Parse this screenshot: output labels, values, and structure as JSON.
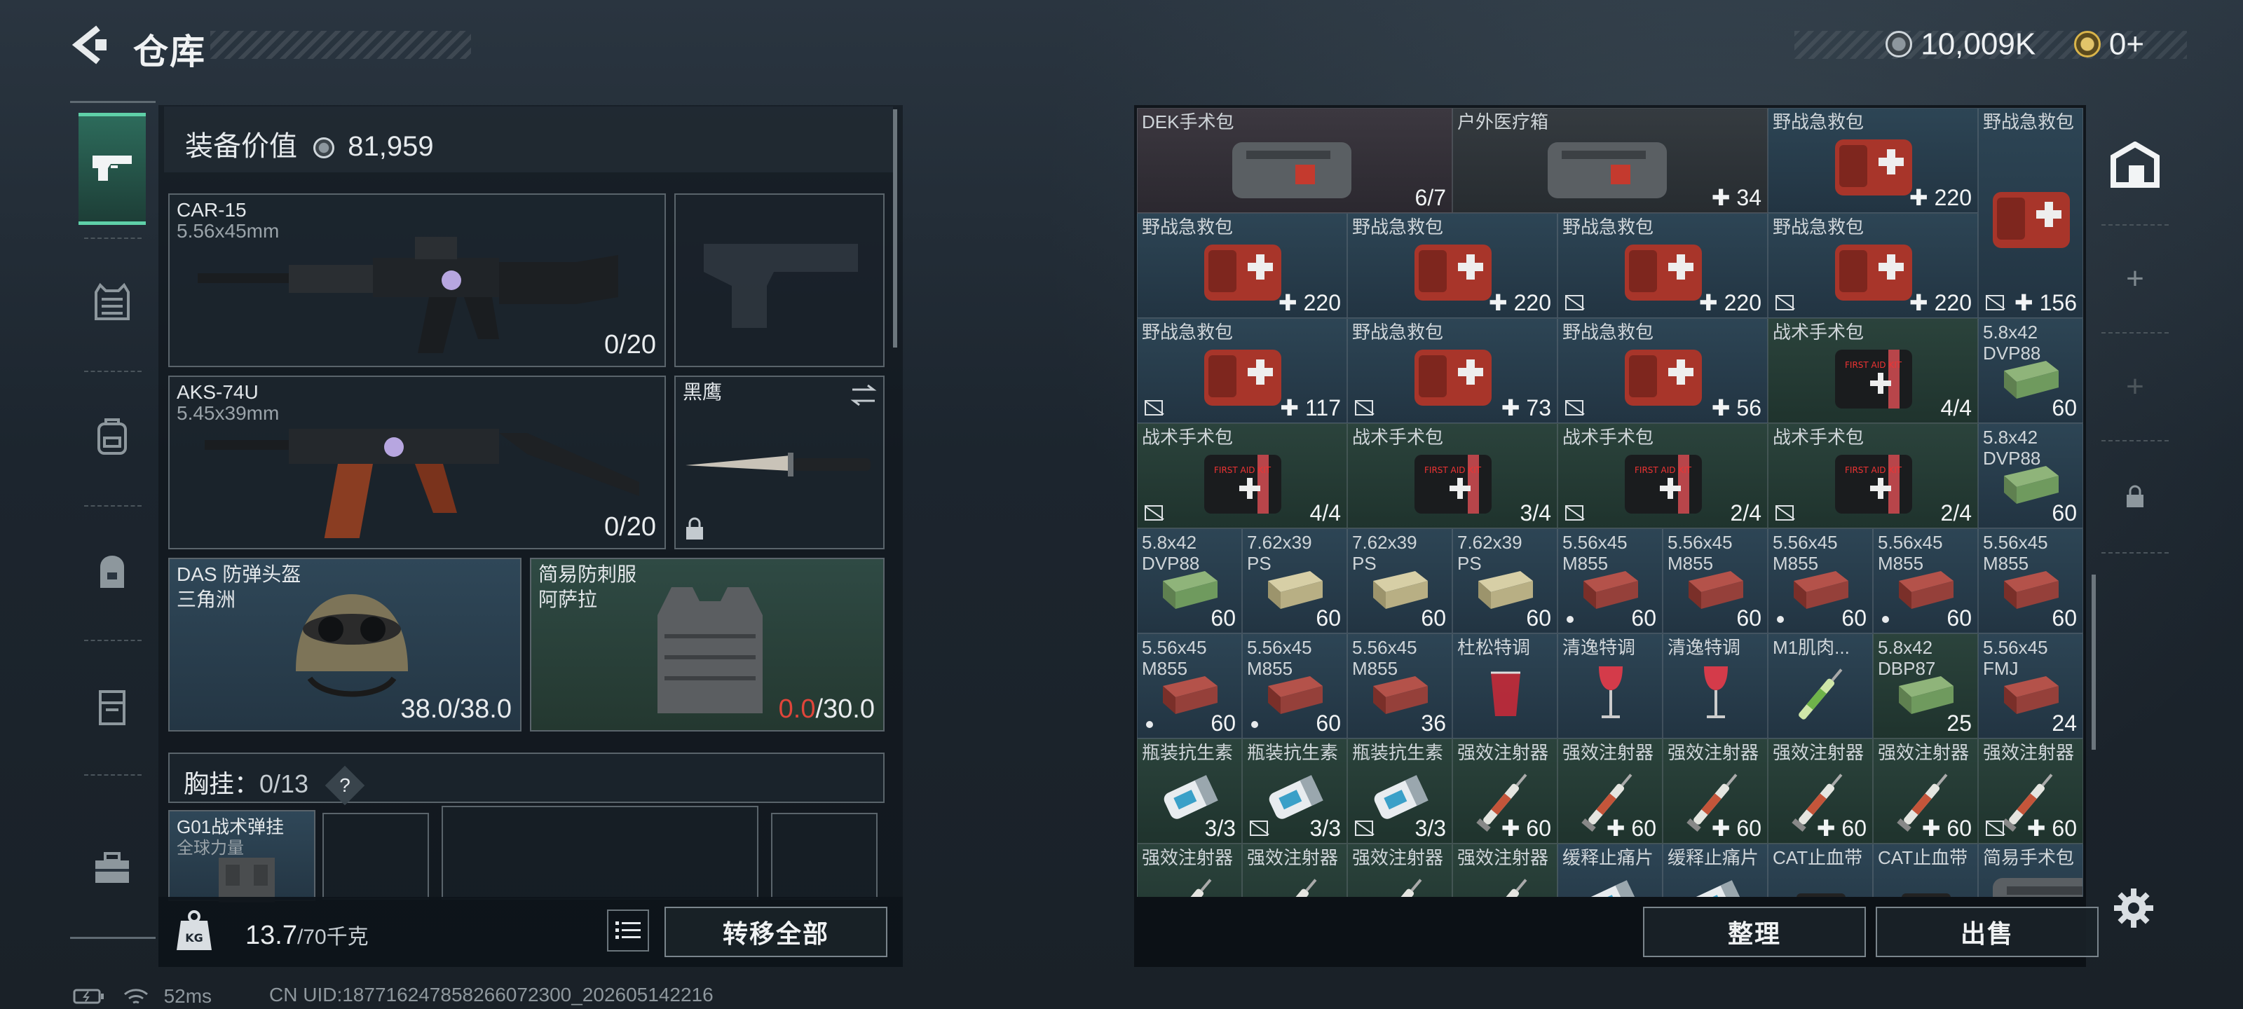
{
  "header": {
    "title": "仓库",
    "money": "10,009K",
    "coupons": "0+"
  },
  "left": {
    "equip_value_label": "装备价值",
    "equip_value": "81,959",
    "primary": {
      "name": "CAR-15",
      "caliber": "5.56x45mm",
      "ammo": "0/20"
    },
    "secondary": {
      "name": "AKS-74U",
      "caliber": "5.45x39mm",
      "ammo": "0/20"
    },
    "melee": {
      "name": "黑鹰"
    },
    "helmet": {
      "name": "DAS 防弹头盔",
      "origin": "三角洲",
      "durability": "38.0/38.0"
    },
    "armor": {
      "name": "简易防刺服",
      "origin": "阿萨拉",
      "durability_current": "0.0",
      "durability_max": "/30.0"
    },
    "chest": {
      "label": "胸挂：",
      "capacity": "0/13",
      "help": "?",
      "item_name": "G01战术弹挂",
      "item_sub": "全球力量"
    },
    "weight": {
      "current": "13.7",
      "max": "/70千克"
    },
    "transfer_all": "转移全部"
  },
  "footer": {
    "ping": "52ms",
    "uid": "CN UID:18771624785826607230​0_202605142216"
  },
  "actions": {
    "sort": "整理",
    "sell": "出售"
  },
  "colors": {
    "accent_green": "#5fd0a8",
    "durability_low": "#e0453a"
  },
  "grid": [
    {
      "r": 0,
      "c": 0,
      "w": 3,
      "label": "DEK手术包",
      "count": "6/7",
      "bg": "purple",
      "art": "bag"
    },
    {
      "r": 0,
      "c": 3,
      "w": 3,
      "label": "户外医疗箱",
      "count": "✚ 34",
      "bg": "gray",
      "art": "bag"
    },
    {
      "r": 0,
      "c": 6,
      "w": 2,
      "label": "野战急救包",
      "count": "✚ 220",
      "bg": "blue",
      "art": "medkit"
    },
    {
      "r": 0,
      "c": 8,
      "w": 1,
      "h": 2,
      "label": "野战急救包",
      "count": "✚ 156",
      "bg": "blue",
      "art": "medkit",
      "icon": true
    },
    {
      "r": 1,
      "c": 0,
      "w": 2,
      "label": "野战急救包",
      "count": "✚ 220",
      "bg": "blue",
      "art": "medkit"
    },
    {
      "r": 1,
      "c": 2,
      "w": 2,
      "label": "野战急救包",
      "count": "✚ 220",
      "bg": "blue",
      "art": "medkit"
    },
    {
      "r": 1,
      "c": 4,
      "w": 2,
      "label": "野战急救包",
      "count": "✚ 220",
      "bg": "blue",
      "art": "medkit",
      "icon": true
    },
    {
      "r": 1,
      "c": 6,
      "w": 2,
      "label": "野战急救包",
      "count": "✚ 220",
      "bg": "blue",
      "art": "medkit",
      "icon": true
    },
    {
      "r": 2,
      "c": 0,
      "w": 2,
      "label": "野战急救包",
      "count": "✚ 117",
      "bg": "blue",
      "art": "medkit",
      "icon": true
    },
    {
      "r": 2,
      "c": 2,
      "w": 2,
      "label": "野战急救包",
      "count": "✚ 73",
      "bg": "blue",
      "art": "medkit",
      "icon": true
    },
    {
      "r": 2,
      "c": 4,
      "w": 2,
      "label": "野战急救包",
      "count": "✚ 56",
      "bg": "blue",
      "art": "medkit",
      "icon": true
    },
    {
      "r": 2,
      "c": 6,
      "w": 2,
      "label": "战术手术包",
      "count": "4/4",
      "bg": "green",
      "art": "tbag"
    },
    {
      "r": 2,
      "c": 8,
      "w": 1,
      "label": "5.8x42\nDVP88",
      "count": "60",
      "bg": "blue",
      "art": "ammo_green"
    },
    {
      "r": 3,
      "c": 0,
      "w": 2,
      "label": "战术手术包",
      "count": "4/4",
      "bg": "green",
      "art": "tbag",
      "icon": true
    },
    {
      "r": 3,
      "c": 2,
      "w": 2,
      "label": "战术手术包",
      "count": "3/4",
      "bg": "green",
      "art": "tbag"
    },
    {
      "r": 3,
      "c": 4,
      "w": 2,
      "label": "战术手术包",
      "count": "2/4",
      "bg": "green",
      "art": "tbag",
      "icon": true
    },
    {
      "r": 3,
      "c": 6,
      "w": 2,
      "label": "战术手术包",
      "count": "2/4",
      "bg": "green",
      "art": "tbag",
      "icon": true
    },
    {
      "r": 3,
      "c": 8,
      "w": 1,
      "label": "5.8x42\nDVP88",
      "count": "60",
      "bg": "blue",
      "art": "ammo_green"
    },
    {
      "r": 4,
      "c": 0,
      "w": 1,
      "label": "5.8x42\nDVP88",
      "count": "60",
      "bg": "blue",
      "art": "ammo_green"
    },
    {
      "r": 4,
      "c": 1,
      "w": 1,
      "label": "7.62x39\nPS",
      "count": "60",
      "bg": "blue",
      "art": "ammo_tan"
    },
    {
      "r": 4,
      "c": 2,
      "w": 1,
      "label": "7.62x39\nPS",
      "count": "60",
      "bg": "blue",
      "art": "ammo_tan"
    },
    {
      "r": 4,
      "c": 3,
      "w": 1,
      "label": "7.62x39\nPS",
      "count": "60",
      "bg": "blue",
      "art": "ammo_tan"
    },
    {
      "r": 4,
      "c": 4,
      "w": 1,
      "label": "5.56x45\nM855",
      "count": "60",
      "bg": "blue",
      "art": "ammo_red",
      "dot": true
    },
    {
      "r": 4,
      "c": 5,
      "w": 1,
      "label": "5.56x45\nM855",
      "count": "60",
      "bg": "blue",
      "art": "ammo_red"
    },
    {
      "r": 4,
      "c": 6,
      "w": 1,
      "label": "5.56x45\nM855",
      "count": "60",
      "bg": "blue",
      "art": "ammo_red",
      "dot": true
    },
    {
      "r": 4,
      "c": 7,
      "w": 1,
      "label": "5.56x45\nM855",
      "count": "60",
      "bg": "blue",
      "art": "ammo_red",
      "dot": true
    },
    {
      "r": 4,
      "c": 8,
      "w": 1,
      "label": "5.56x45\nM855",
      "count": "60",
      "bg": "blue",
      "art": "ammo_red"
    },
    {
      "r": 5,
      "c": 0,
      "w": 1,
      "label": "5.56x45\nM855",
      "count": "60",
      "bg": "blue",
      "art": "ammo_red",
      "dot": true
    },
    {
      "r": 5,
      "c": 1,
      "w": 1,
      "label": "5.56x45\nM855",
      "count": "60",
      "bg": "blue",
      "art": "ammo_red",
      "dot": true
    },
    {
      "r": 5,
      "c": 2,
      "w": 1,
      "label": "5.56x45\nM855",
      "count": "36",
      "bg": "blue",
      "art": "ammo_red"
    },
    {
      "r": 5,
      "c": 3,
      "w": 1,
      "label": "杜松特调",
      "count": "",
      "bg": "blue",
      "art": "glass"
    },
    {
      "r": 5,
      "c": 4,
      "w": 1,
      "label": "清逸特调",
      "count": "",
      "bg": "blue",
      "art": "wine"
    },
    {
      "r": 5,
      "c": 5,
      "w": 1,
      "label": "清逸特调",
      "count": "",
      "bg": "blue",
      "art": "wine"
    },
    {
      "r": 5,
      "c": 6,
      "w": 1,
      "label": "M1肌肉...",
      "count": "",
      "bg": "blue",
      "art": "syringe_green"
    },
    {
      "r": 5,
      "c": 7,
      "w": 1,
      "label": "5.8x42\nDBP87",
      "count": "25",
      "bg": "green",
      "art": "ammo_green"
    },
    {
      "r": 5,
      "c": 8,
      "w": 1,
      "label": "5.56x45\nFMJ",
      "count": "24",
      "bg": "blue",
      "art": "ammo_red"
    },
    {
      "r": 6,
      "c": 0,
      "w": 1,
      "label": "瓶装抗生素",
      "count": "3/3",
      "bg": "green",
      "art": "pills"
    },
    {
      "r": 6,
      "c": 1,
      "w": 1,
      "label": "瓶装抗生素",
      "count": "3/3",
      "bg": "green",
      "art": "pills",
      "icon": true
    },
    {
      "r": 6,
      "c": 2,
      "w": 1,
      "label": "瓶装抗生素",
      "count": "3/3",
      "bg": "green",
      "art": "pills",
      "icon": true
    },
    {
      "r": 6,
      "c": 3,
      "w": 1,
      "label": "强效注射器",
      "count": "✚ 60",
      "bg": "green",
      "art": "syringe"
    },
    {
      "r": 6,
      "c": 4,
      "w": 1,
      "label": "强效注射器",
      "count": "✚ 60",
      "bg": "green",
      "art": "syringe"
    },
    {
      "r": 6,
      "c": 5,
      "w": 1,
      "label": "强效注射器",
      "count": "✚ 60",
      "bg": "green",
      "art": "syringe"
    },
    {
      "r": 6,
      "c": 6,
      "w": 1,
      "label": "强效注射器",
      "count": "✚ 60",
      "bg": "green",
      "art": "syringe"
    },
    {
      "r": 6,
      "c": 7,
      "w": 1,
      "label": "强效注射器",
      "count": "✚ 60",
      "bg": "green",
      "art": "syringe"
    },
    {
      "r": 6,
      "c": 8,
      "w": 1,
      "label": "强效注射器",
      "count": "✚ 60",
      "bg": "green",
      "art": "syringe",
      "icon": true
    },
    {
      "r": 7,
      "c": 0,
      "w": 1,
      "label": "强效注射器",
      "count": "",
      "bg": "green",
      "art": "syringe"
    },
    {
      "r": 7,
      "c": 1,
      "w": 1,
      "label": "强效注射器",
      "count": "",
      "bg": "green",
      "art": "syringe"
    },
    {
      "r": 7,
      "c": 2,
      "w": 1,
      "label": "强效注射器",
      "count": "",
      "bg": "green",
      "art": "syringe"
    },
    {
      "r": 7,
      "c": 3,
      "w": 1,
      "label": "强效注射器",
      "count": "",
      "bg": "green",
      "art": "syringe"
    },
    {
      "r": 7,
      "c": 4,
      "w": 1,
      "label": "缓释止痛片",
      "count": "",
      "bg": "blue",
      "art": "pills"
    },
    {
      "r": 7,
      "c": 5,
      "w": 1,
      "label": "缓释止痛片",
      "count": "",
      "bg": "blue",
      "art": "pills"
    },
    {
      "r": 7,
      "c": 6,
      "w": 1,
      "label": "CAT止血带",
      "count": "",
      "bg": "blue",
      "art": "tourniquet"
    },
    {
      "r": 7,
      "c": 7,
      "w": 1,
      "label": "CAT止血带",
      "count": "",
      "bg": "blue",
      "art": "tourniquet"
    },
    {
      "r": 7,
      "c": 8,
      "w": 1,
      "label": "简易手术包",
      "count": "",
      "bg": "blue",
      "art": "bag"
    }
  ]
}
